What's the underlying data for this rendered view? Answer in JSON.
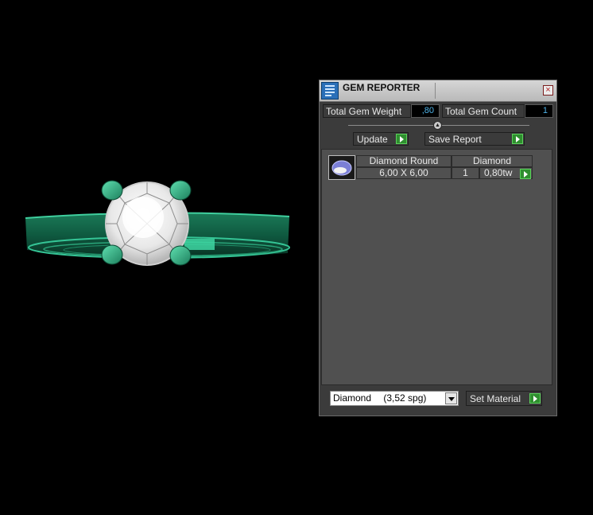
{
  "panel": {
    "title": "GEM REPORTER",
    "total_gem_weight_label": "Total Gem Weight",
    "total_gem_weight_value": ",80",
    "total_gem_count_label": "Total Gem Count",
    "total_gem_count_value": "1",
    "update_label": "Update",
    "save_report_label": "Save Report",
    "gem_row": {
      "shape": "Diamond Round",
      "size": "6,00 X 6,00",
      "material": "Diamond",
      "count": "1",
      "weight": "0,80tw"
    },
    "material_select": {
      "name": "Diamond",
      "spg": "(3,52 spg)"
    },
    "set_material_label": "Set Material"
  },
  "icons": {
    "app": "gem-reporter-icon",
    "close": "close-icon",
    "slider": "slider-thumb-icon",
    "go": "green-play-arrow-icon",
    "dropdown": "chevron-down-icon",
    "gem": "round-gem-thumbnail"
  },
  "colors": {
    "background": "#000000",
    "panel": "#3b3b3b",
    "list": "#505050",
    "accent_green": "#2f8f2f",
    "value_blue": "#4fb3e8",
    "ring_green": "#2aa57a"
  }
}
